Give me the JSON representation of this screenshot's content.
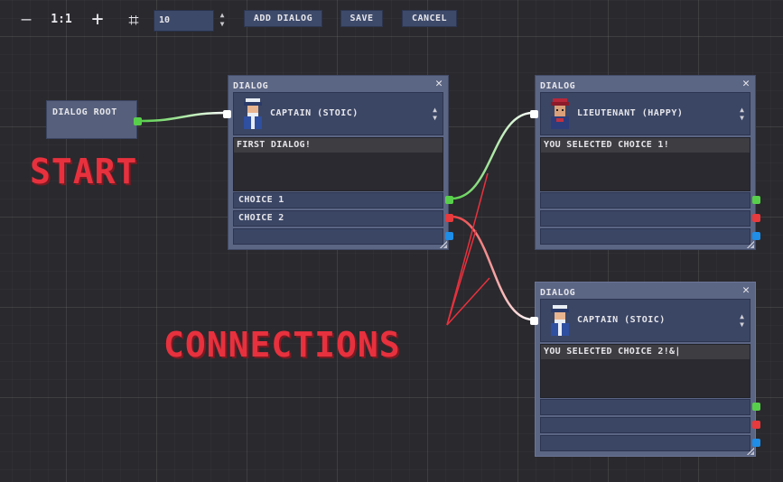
{
  "toolbar": {
    "zoom_out_icon": "minus-icon",
    "zoom_out_glyph": "—",
    "zoom_reset_label": "1:1",
    "zoom_in_icon": "plus-icon",
    "zoom_in_glyph": "+",
    "snap_icon": "grid-snap-icon",
    "snap_glyph": "⌗",
    "snap_value": "10",
    "add_dialog_label": "ADD DIALOG",
    "save_label": "SAVE",
    "cancel_label": "CANCEL"
  },
  "root_node": {
    "label": "DIALOG ROOT"
  },
  "nodes": [
    {
      "title": "DIALOG",
      "close": "✕",
      "speaker": "CAPTAIN (STOIC)",
      "avatar": "captain-avatar",
      "text": "FIRST DIALOG!",
      "choices": [
        "CHOICE 1",
        "CHOICE 2",
        ""
      ]
    },
    {
      "title": "DIALOG",
      "close": "✕",
      "speaker": "LIEUTENANT (HAPPY)",
      "avatar": "lieutenant-avatar",
      "text": "YOU SELECTED CHOICE 1!",
      "choices": [
        "",
        "",
        ""
      ]
    },
    {
      "title": "DIALOG",
      "close": "✕",
      "speaker": "CAPTAIN (STOIC)",
      "avatar": "captain-avatar",
      "text": "YOU SELECTED CHOICE 2!&|",
      "choices": [
        "",
        "",
        ""
      ]
    }
  ],
  "annotations": {
    "start": "START",
    "connections": "CONNECTIONS"
  },
  "colors": {
    "port_green": "#58cf4b",
    "port_red": "#e8393c",
    "port_blue": "#1e8ee8",
    "annotation_red": "#e8313e",
    "node_bg": "#5b6584",
    "field_bg": "#3b4665"
  }
}
